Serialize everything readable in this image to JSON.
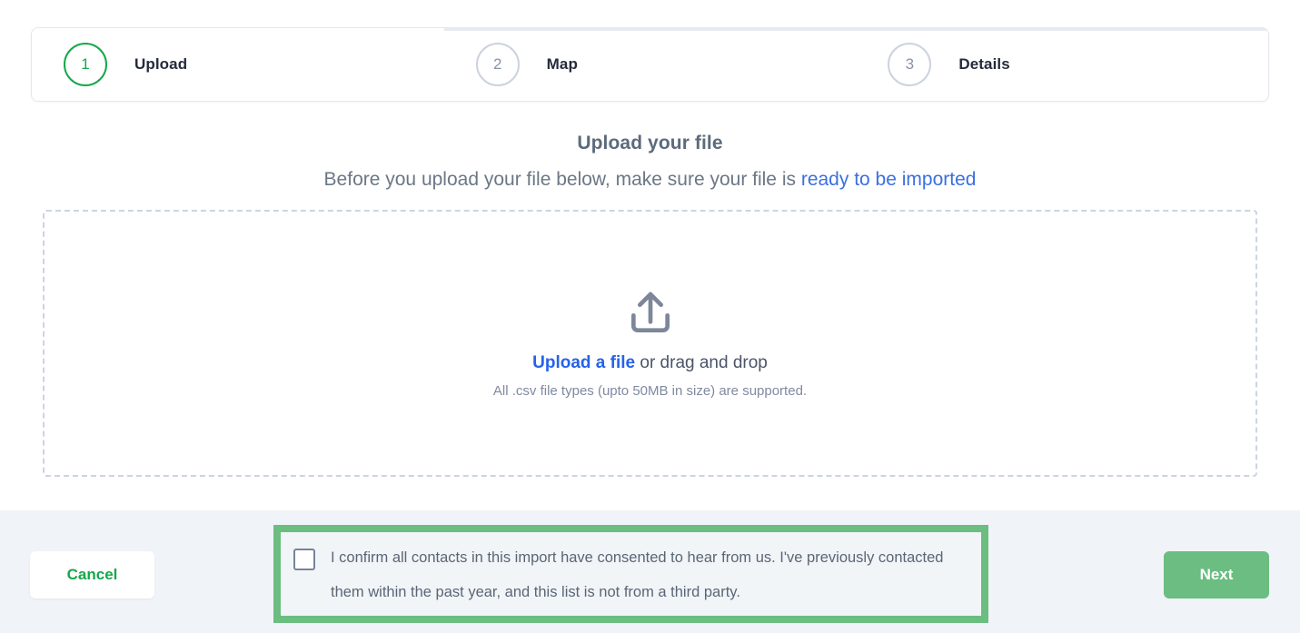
{
  "stepper": {
    "steps": [
      {
        "number": "1",
        "label": "Upload",
        "state": "active"
      },
      {
        "number": "2",
        "label": "Map",
        "state": "inactive"
      },
      {
        "number": "3",
        "label": "Details",
        "state": "inactive"
      }
    ]
  },
  "headings": {
    "title": "Upload your file",
    "subtitle_before": "Before you upload your file below, make sure your file is ",
    "subtitle_link": "ready to be imported"
  },
  "dropzone": {
    "icon": "upload-arrow-tray-icon",
    "link_label": "Upload a file",
    "main_rest": " or drag and drop",
    "sub_text": "All .csv file types (upto 50MB in size) are supported."
  },
  "footer": {
    "cancel_label": "Cancel",
    "next_label": "Next",
    "consent_text": "I confirm all contacts in this import have consented to hear from us. I've previously contacted them within the past year, and this list is not from a third party.",
    "consent_checked": false
  },
  "colors": {
    "accent_green": "#15a84a",
    "next_button_green": "#6bbd82",
    "highlight_green": "#6cbd80",
    "link_blue": "#2563eb",
    "subtitle_link_blue": "#3b6fe0",
    "footer_bg": "#f0f3f7",
    "dash_border": "#ccd4e0"
  }
}
